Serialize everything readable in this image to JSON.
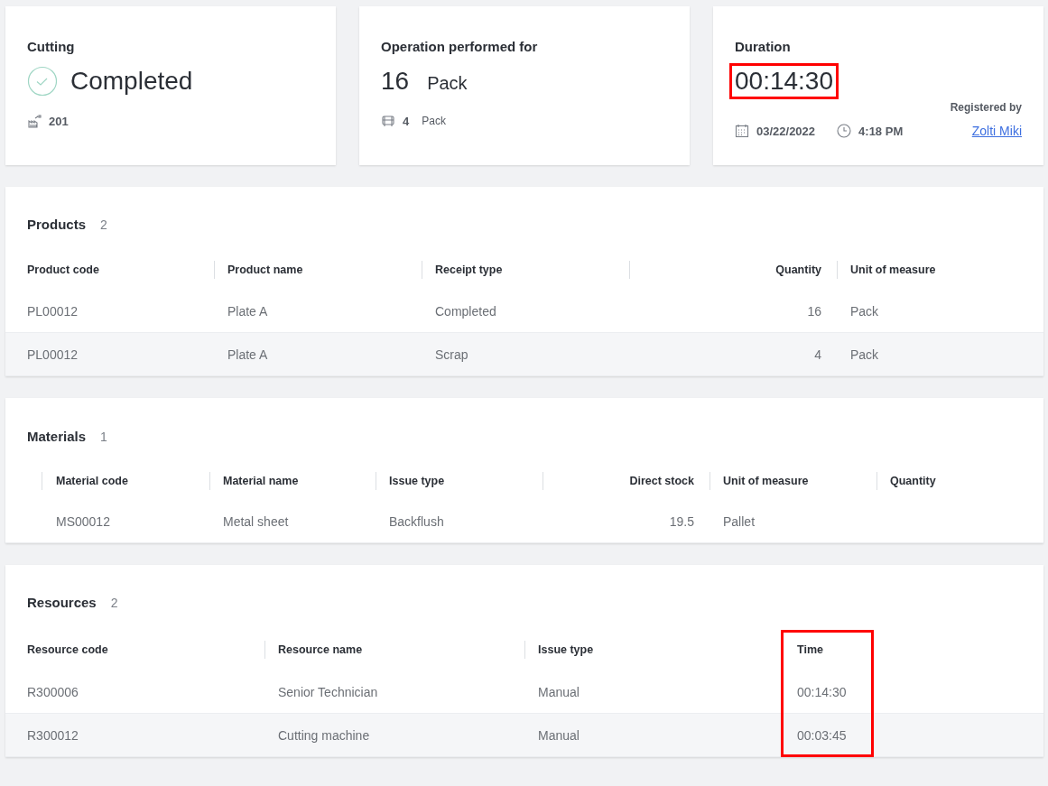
{
  "summary_cards": [
    {
      "kind": "status",
      "title": "Cutting",
      "value": "Completed",
      "footer": "201"
    },
    {
      "kind": "quantity",
      "title": "Operation performed for",
      "value": "16",
      "unit": "Pack",
      "footer_value": "4",
      "footer_unit": "Pack"
    },
    {
      "kind": "duration",
      "title": "Duration",
      "value": "00:14:30",
      "highlighted": true,
      "date": "03/22/2022",
      "time": "4:18 PM",
      "registered_label": "Registered by",
      "registered_by": "Zolti Miki"
    }
  ],
  "tables": [
    {
      "kind": "products",
      "title": "Products",
      "count": "2",
      "columns": [
        {
          "label": "Product code",
          "kind": "text"
        },
        {
          "label": "Product name",
          "kind": "text"
        },
        {
          "label": "Receipt type",
          "kind": "text"
        },
        {
          "label": "Quantity",
          "kind": "number"
        },
        {
          "label": "Unit of measure",
          "kind": "text"
        }
      ],
      "rows": [
        [
          "PL00012",
          "Plate A",
          "Completed",
          "16",
          "Pack"
        ],
        [
          "PL00012",
          "Plate A",
          "Scrap",
          "4",
          "Pack"
        ]
      ]
    },
    {
      "kind": "materials",
      "title": "Materials",
      "count": "1",
      "columns": [
        {
          "label": "Material code",
          "kind": "text"
        },
        {
          "label": "Material name",
          "kind": "text"
        },
        {
          "label": "Issue type",
          "kind": "text"
        },
        {
          "label": "Direct stock",
          "kind": "number"
        },
        {
          "label": "Unit of measure",
          "kind": "text"
        },
        {
          "label": "Quantity",
          "kind": "text"
        }
      ],
      "rows": [
        [
          "MS00012",
          "Metal sheet",
          "Backflush",
          "19.5",
          "Pallet"
        ]
      ]
    },
    {
      "kind": "resources",
      "title": "Resources",
      "count": "2",
      "columns": [
        {
          "label": "Resource code",
          "kind": "text",
          "highlighted": false
        },
        {
          "label": "Resource name",
          "kind": "text",
          "highlighted": false
        },
        {
          "label": "Issue type",
          "kind": "text",
          "highlighted": false
        },
        {
          "label": "Time",
          "kind": "text",
          "highlighted": true
        }
      ],
      "rows": [
        [
          "R300006",
          "Senior Technician",
          "Manual",
          "00:14:30"
        ],
        [
          "R300012",
          "Cutting machine",
          "Manual",
          "00:03:45"
        ]
      ]
    }
  ]
}
